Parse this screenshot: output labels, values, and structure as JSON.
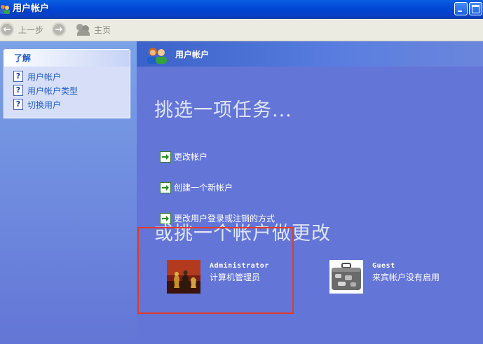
{
  "window": {
    "title": "用户帐户"
  },
  "toolbar": {
    "back_label": "上一步",
    "home_label": "主页"
  },
  "sidebar": {
    "panel_title": "了解",
    "items": [
      {
        "label": "用户帐户"
      },
      {
        "label": "用户帐户类型"
      },
      {
        "label": "切换用户"
      }
    ]
  },
  "main": {
    "header_title": "用户帐户",
    "tasks_heading": "挑选一项任务...",
    "tasks": [
      {
        "label": "更改帐户"
      },
      {
        "label": "创建一个新帐户"
      },
      {
        "label": "更改用户登录或注销的方式"
      }
    ],
    "accounts_heading": "或挑一个帐户做更改",
    "accounts": [
      {
        "name": "Administrator",
        "role": "计算机管理员"
      },
      {
        "name": "Guest",
        "role": "来宾帐户没有启用"
      }
    ]
  },
  "colors": {
    "title_bar": "#0046d5",
    "main_bg": "#6375d6",
    "highlight": "#e23a2b",
    "link": "#215dc6"
  }
}
